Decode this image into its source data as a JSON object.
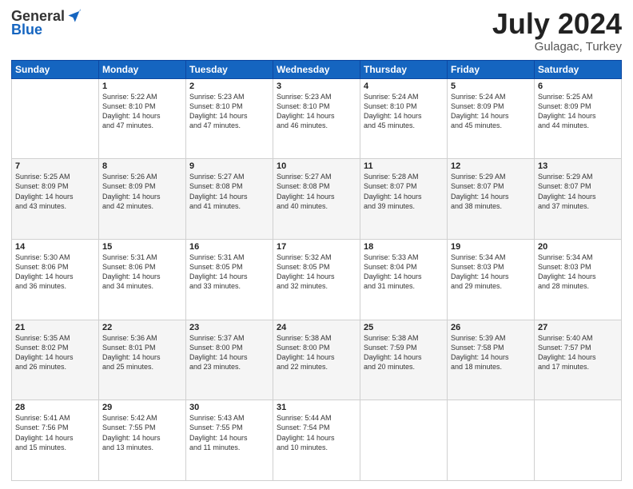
{
  "header": {
    "logo_general": "General",
    "logo_blue": "Blue",
    "month_year": "July 2024",
    "location": "Gulagac, Turkey"
  },
  "weekdays": [
    "Sunday",
    "Monday",
    "Tuesday",
    "Wednesday",
    "Thursday",
    "Friday",
    "Saturday"
  ],
  "weeks": [
    [
      {
        "day": "",
        "content": ""
      },
      {
        "day": "1",
        "content": "Sunrise: 5:22 AM\nSunset: 8:10 PM\nDaylight: 14 hours\nand 47 minutes."
      },
      {
        "day": "2",
        "content": "Sunrise: 5:23 AM\nSunset: 8:10 PM\nDaylight: 14 hours\nand 47 minutes."
      },
      {
        "day": "3",
        "content": "Sunrise: 5:23 AM\nSunset: 8:10 PM\nDaylight: 14 hours\nand 46 minutes."
      },
      {
        "day": "4",
        "content": "Sunrise: 5:24 AM\nSunset: 8:10 PM\nDaylight: 14 hours\nand 45 minutes."
      },
      {
        "day": "5",
        "content": "Sunrise: 5:24 AM\nSunset: 8:09 PM\nDaylight: 14 hours\nand 45 minutes."
      },
      {
        "day": "6",
        "content": "Sunrise: 5:25 AM\nSunset: 8:09 PM\nDaylight: 14 hours\nand 44 minutes."
      }
    ],
    [
      {
        "day": "7",
        "content": "Sunrise: 5:25 AM\nSunset: 8:09 PM\nDaylight: 14 hours\nand 43 minutes."
      },
      {
        "day": "8",
        "content": "Sunrise: 5:26 AM\nSunset: 8:09 PM\nDaylight: 14 hours\nand 42 minutes."
      },
      {
        "day": "9",
        "content": "Sunrise: 5:27 AM\nSunset: 8:08 PM\nDaylight: 14 hours\nand 41 minutes."
      },
      {
        "day": "10",
        "content": "Sunrise: 5:27 AM\nSunset: 8:08 PM\nDaylight: 14 hours\nand 40 minutes."
      },
      {
        "day": "11",
        "content": "Sunrise: 5:28 AM\nSunset: 8:07 PM\nDaylight: 14 hours\nand 39 minutes."
      },
      {
        "day": "12",
        "content": "Sunrise: 5:29 AM\nSunset: 8:07 PM\nDaylight: 14 hours\nand 38 minutes."
      },
      {
        "day": "13",
        "content": "Sunrise: 5:29 AM\nSunset: 8:07 PM\nDaylight: 14 hours\nand 37 minutes."
      }
    ],
    [
      {
        "day": "14",
        "content": "Sunrise: 5:30 AM\nSunset: 8:06 PM\nDaylight: 14 hours\nand 36 minutes."
      },
      {
        "day": "15",
        "content": "Sunrise: 5:31 AM\nSunset: 8:06 PM\nDaylight: 14 hours\nand 34 minutes."
      },
      {
        "day": "16",
        "content": "Sunrise: 5:31 AM\nSunset: 8:05 PM\nDaylight: 14 hours\nand 33 minutes."
      },
      {
        "day": "17",
        "content": "Sunrise: 5:32 AM\nSunset: 8:05 PM\nDaylight: 14 hours\nand 32 minutes."
      },
      {
        "day": "18",
        "content": "Sunrise: 5:33 AM\nSunset: 8:04 PM\nDaylight: 14 hours\nand 31 minutes."
      },
      {
        "day": "19",
        "content": "Sunrise: 5:34 AM\nSunset: 8:03 PM\nDaylight: 14 hours\nand 29 minutes."
      },
      {
        "day": "20",
        "content": "Sunrise: 5:34 AM\nSunset: 8:03 PM\nDaylight: 14 hours\nand 28 minutes."
      }
    ],
    [
      {
        "day": "21",
        "content": "Sunrise: 5:35 AM\nSunset: 8:02 PM\nDaylight: 14 hours\nand 26 minutes."
      },
      {
        "day": "22",
        "content": "Sunrise: 5:36 AM\nSunset: 8:01 PM\nDaylight: 14 hours\nand 25 minutes."
      },
      {
        "day": "23",
        "content": "Sunrise: 5:37 AM\nSunset: 8:00 PM\nDaylight: 14 hours\nand 23 minutes."
      },
      {
        "day": "24",
        "content": "Sunrise: 5:38 AM\nSunset: 8:00 PM\nDaylight: 14 hours\nand 22 minutes."
      },
      {
        "day": "25",
        "content": "Sunrise: 5:38 AM\nSunset: 7:59 PM\nDaylight: 14 hours\nand 20 minutes."
      },
      {
        "day": "26",
        "content": "Sunrise: 5:39 AM\nSunset: 7:58 PM\nDaylight: 14 hours\nand 18 minutes."
      },
      {
        "day": "27",
        "content": "Sunrise: 5:40 AM\nSunset: 7:57 PM\nDaylight: 14 hours\nand 17 minutes."
      }
    ],
    [
      {
        "day": "28",
        "content": "Sunrise: 5:41 AM\nSunset: 7:56 PM\nDaylight: 14 hours\nand 15 minutes."
      },
      {
        "day": "29",
        "content": "Sunrise: 5:42 AM\nSunset: 7:55 PM\nDaylight: 14 hours\nand 13 minutes."
      },
      {
        "day": "30",
        "content": "Sunrise: 5:43 AM\nSunset: 7:55 PM\nDaylight: 14 hours\nand 11 minutes."
      },
      {
        "day": "31",
        "content": "Sunrise: 5:44 AM\nSunset: 7:54 PM\nDaylight: 14 hours\nand 10 minutes."
      },
      {
        "day": "",
        "content": ""
      },
      {
        "day": "",
        "content": ""
      },
      {
        "day": "",
        "content": ""
      }
    ]
  ]
}
